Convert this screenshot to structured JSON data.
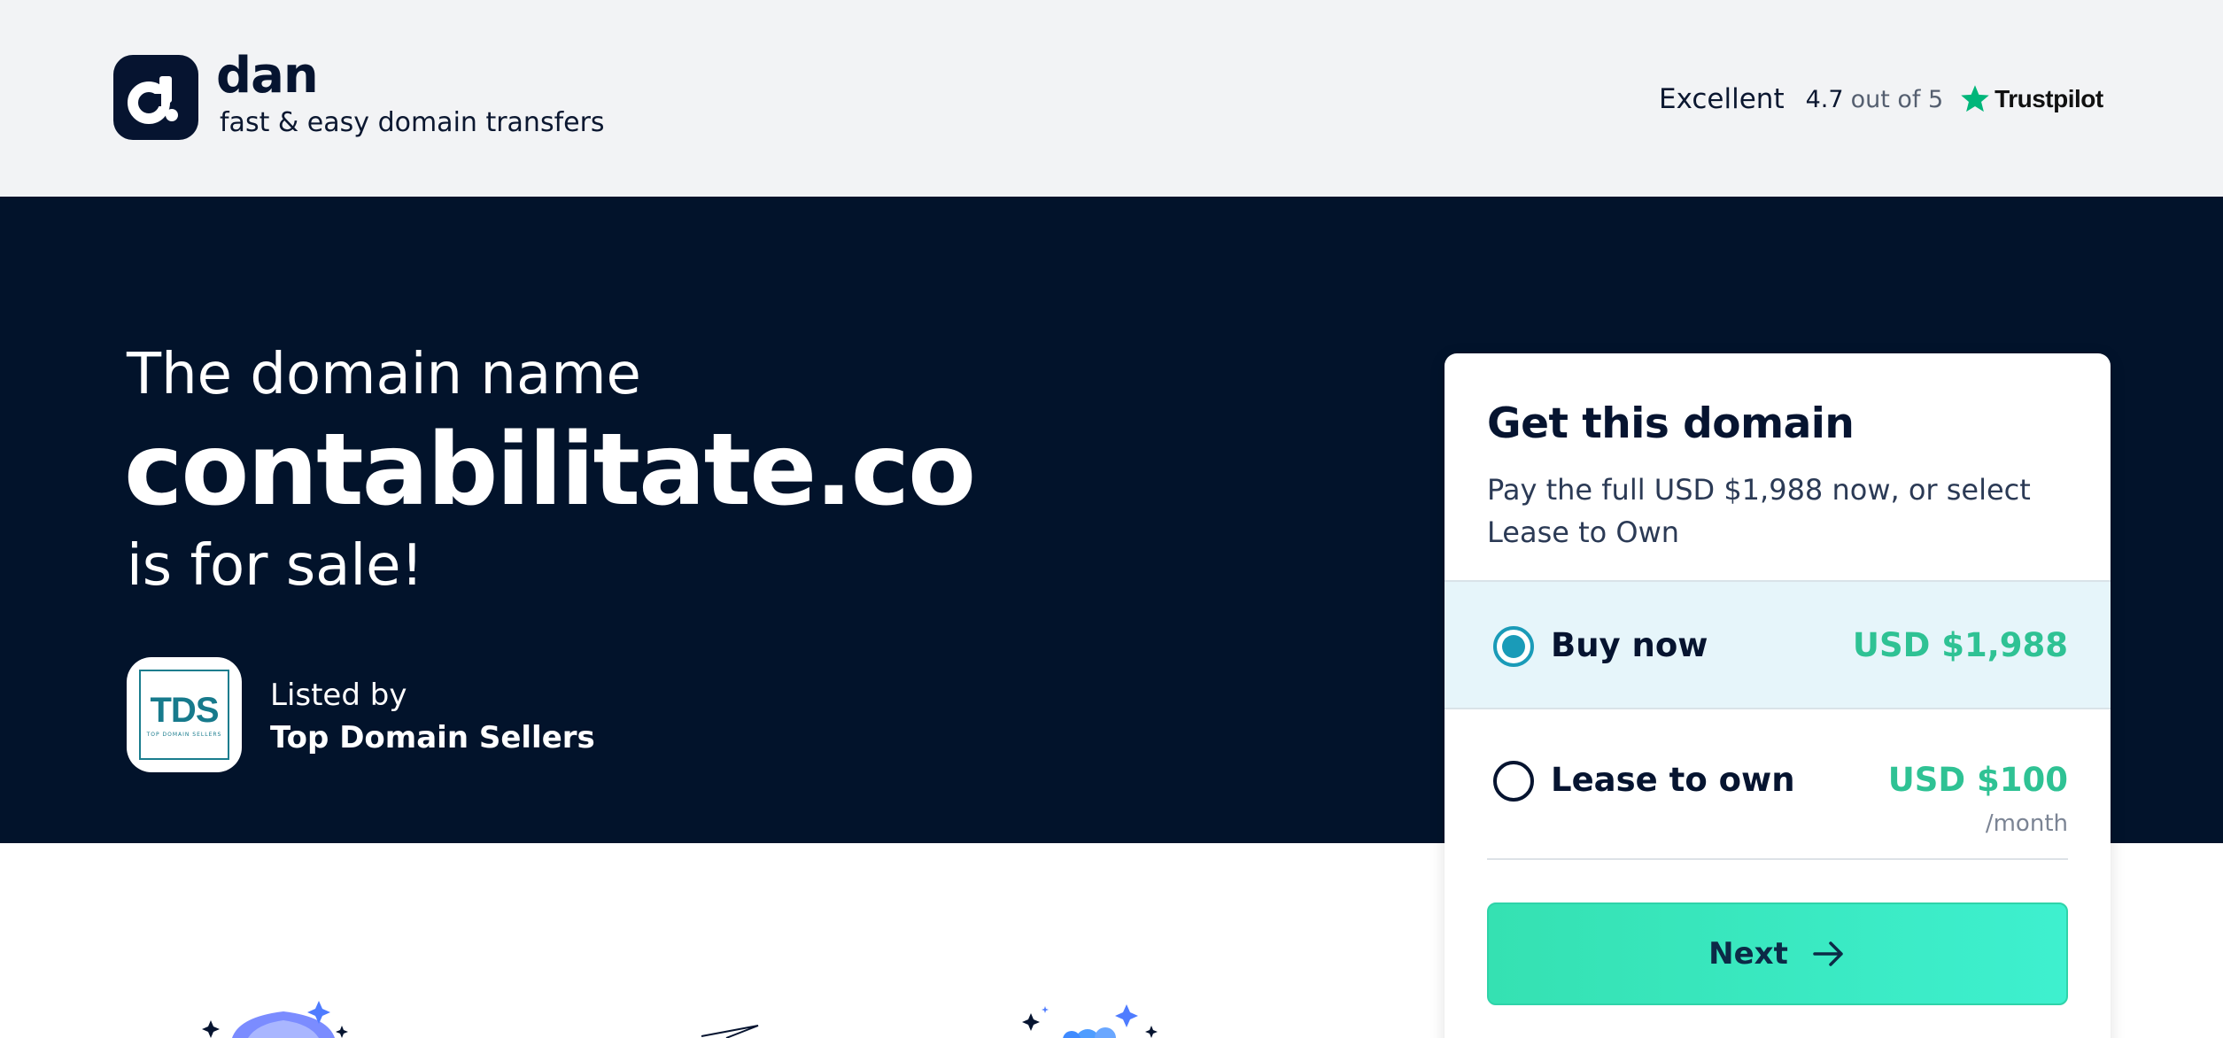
{
  "header": {
    "brand_name": "dan",
    "brand_tagline": "fast & easy domain transfers",
    "trustpilot": {
      "rating_word": "Excellent",
      "score": "4.7",
      "out_of": "out of 5",
      "brand": "Trustpilot",
      "star_color": "#00b67a"
    }
  },
  "hero": {
    "intro": "The domain name",
    "domain": "contabilitate.co",
    "status": "is for sale!",
    "seller": {
      "logo_text": "TDS",
      "logo_subtext": "TOP DOMAIN SELLERS",
      "listed_by_label": "Listed by",
      "name": "Top Domain Sellers"
    }
  },
  "card": {
    "title": "Get this domain",
    "description": "Pay the full USD $1,988 now, or select Lease to Own",
    "options": [
      {
        "label": "Buy now",
        "price": "USD $1,988",
        "selected": true
      },
      {
        "label": "Lease to own",
        "price": "USD $100",
        "unit": "/month",
        "selected": false
      }
    ],
    "next_label": "Next"
  },
  "colors": {
    "header_bg": "#f2f3f5",
    "hero_bg": "#02132b",
    "accent_green": "#2fc294",
    "selected_bg": "#e6f5fa",
    "radio_blue": "#1a9bb8"
  },
  "icons": [
    "dan-logo-icon",
    "trustpilot-star-icon",
    "tds-logo",
    "radio-selected-icon",
    "radio-unselected-icon",
    "arrow-right-icon",
    "shield-illustration",
    "paper-plane-illustration",
    "cloud-illustration"
  ]
}
